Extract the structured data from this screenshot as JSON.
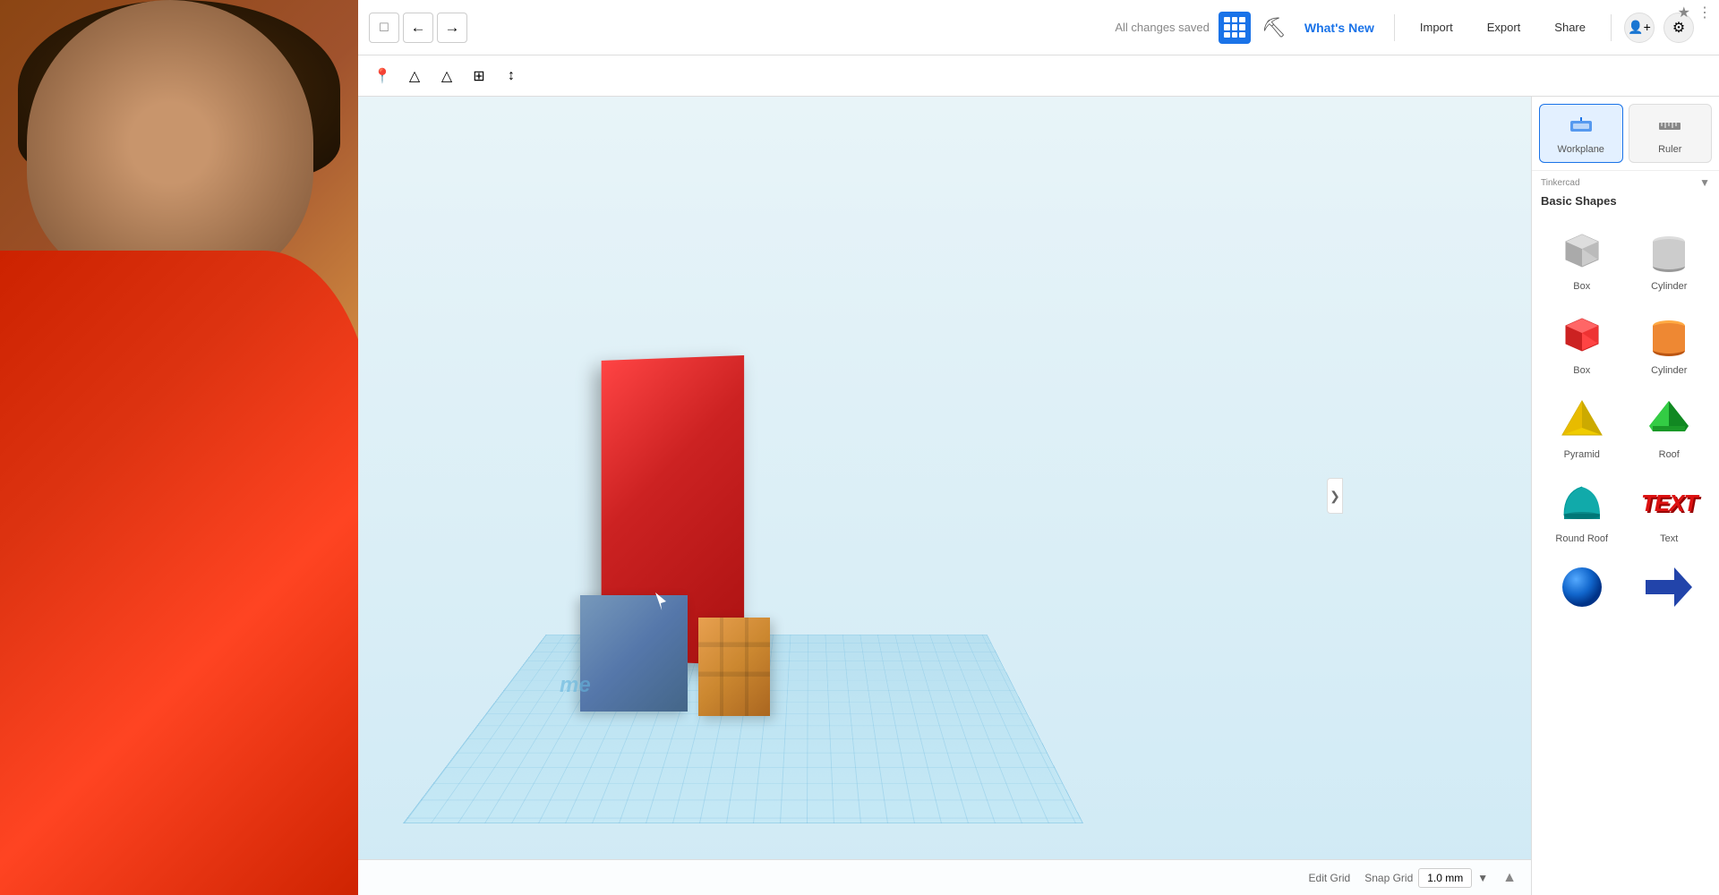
{
  "app": {
    "title": "Tinkercad",
    "status": "All changes saved"
  },
  "toolbar": {
    "undo_label": "←",
    "redo_label": "→",
    "import_label": "Import",
    "export_label": "Export",
    "share_label": "Share",
    "whats_new_label": "What's New",
    "saved_label": "All changes saved"
  },
  "toolbar2": {
    "icons": [
      "◆",
      "△",
      "△",
      "⊞",
      "↕"
    ]
  },
  "tools": {
    "workplane_label": "Workplane",
    "ruler_label": "Ruler"
  },
  "shapes_panel": {
    "brand": "Tinkercad",
    "title": "Basic Shapes",
    "dropdown_arrow": "▼",
    "collapse_arrow": "❯",
    "items": [
      {
        "id": "box-gray",
        "label": "Box",
        "type": "box-gray"
      },
      {
        "id": "cylinder-gray",
        "label": "Cylinder",
        "type": "cylinder-gray"
      },
      {
        "id": "box-red",
        "label": "Box",
        "type": "box-red"
      },
      {
        "id": "cylinder-orange",
        "label": "Cylinder",
        "type": "cylinder-orange"
      },
      {
        "id": "pyramid-yellow",
        "label": "Pyramid",
        "type": "pyramid-yellow"
      },
      {
        "id": "roof-green",
        "label": "Roof",
        "type": "roof-green"
      },
      {
        "id": "round-roof-teal",
        "label": "Round Roof",
        "type": "round-roof-teal"
      },
      {
        "id": "text-shape",
        "label": "Text",
        "type": "text-shape"
      },
      {
        "id": "sphere-blue",
        "label": "",
        "type": "sphere-blue"
      },
      {
        "id": "arrow-blue",
        "label": "",
        "type": "arrow-blue"
      }
    ]
  },
  "viewport": {
    "watermark_text": "me",
    "grid_label": "Edit Grid",
    "snap_label": "Snap Grid",
    "snap_value": "1.0 mm",
    "snap_unit": "▼"
  },
  "icons": {
    "star": "★",
    "kebab": "⋮",
    "undo": "←",
    "redo": "→",
    "add_user": "👤+",
    "settings": "⚙"
  }
}
